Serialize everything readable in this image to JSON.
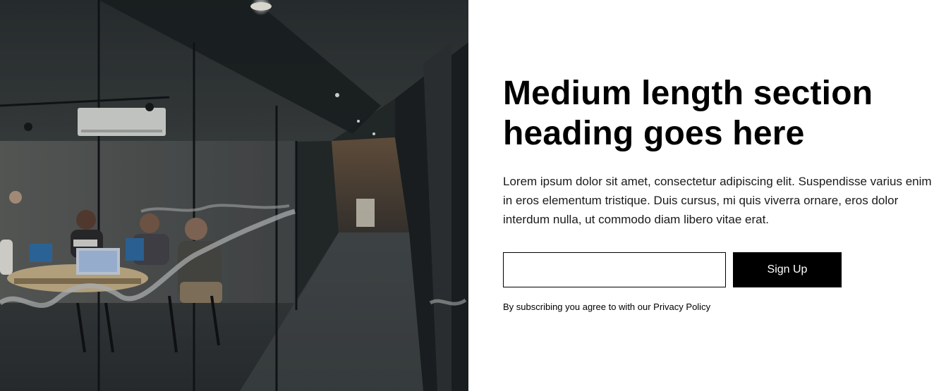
{
  "hero_image": {
    "subject": "office-meeting-room-photo"
  },
  "section": {
    "heading": "Medium length section heading goes here",
    "body": "Lorem ipsum dolor sit amet, consectetur adipiscing elit. Suspendisse varius enim in eros elementum tristique. Duis cursus, mi quis viverra ornare, eros dolor interdum nulla, ut commodo diam libero vitae erat."
  },
  "signup_form": {
    "email_value": "",
    "email_placeholder": "",
    "button_label": "Sign Up",
    "disclaimer": "By subscribing you agree to with our Privacy Policy"
  },
  "colors": {
    "button_bg": "#000000",
    "button_text": "#ffffff",
    "page_bg": "#ffffff"
  }
}
